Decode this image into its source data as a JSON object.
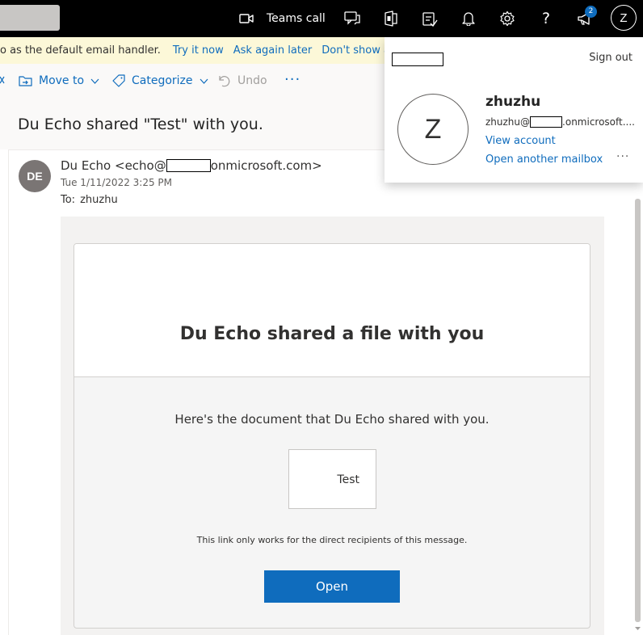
{
  "header": {
    "teams_call_label": "Teams call",
    "help_glyph": "?",
    "notification_count": "2",
    "avatar_initial": "Z",
    "icons": [
      "video-icon",
      "chat-icon",
      "office-icon",
      "tasks-icon",
      "bell-icon",
      "gear-icon",
      "help-icon",
      "megaphone-icon"
    ]
  },
  "infobar": {
    "message": "o as the default email handler.",
    "try_it_now": "Try it now",
    "ask_again_later": "Ask again later",
    "dont_show_again": "Don't show aga"
  },
  "toolbar": {
    "move_to": "Move to",
    "categorize": "Categorize",
    "undo": "Undo",
    "more": "···"
  },
  "message": {
    "subject": "Du Echo shared \"Test\" with you.",
    "sender_initials": "DE",
    "from_prefix": "Du Echo <echo@",
    "from_suffix": "onmicrosoft.com>",
    "date": "Tue 1/11/2022 3:25 PM",
    "to_label": "To:",
    "to_name": "zhuzhu"
  },
  "share_card": {
    "title": "Du Echo shared a file with you",
    "description": "Here's the document that Du Echo shared with you.",
    "file_name": "Test",
    "note": "This link only works for the direct recipients of this message.",
    "open_label": "Open"
  },
  "account_flyout": {
    "sign_out": "Sign out",
    "avatar_initial": "Z",
    "name": "zhuzhu",
    "email_prefix": "zhuzhu@",
    "email_suffix": ".onmicrosoft....",
    "view_account": "View account",
    "open_another_mailbox": "Open another mailbox",
    "more": "···"
  },
  "colors": {
    "accent": "#0f6cbd",
    "topbar": "#000000",
    "infobar": "#fcf8d8"
  }
}
